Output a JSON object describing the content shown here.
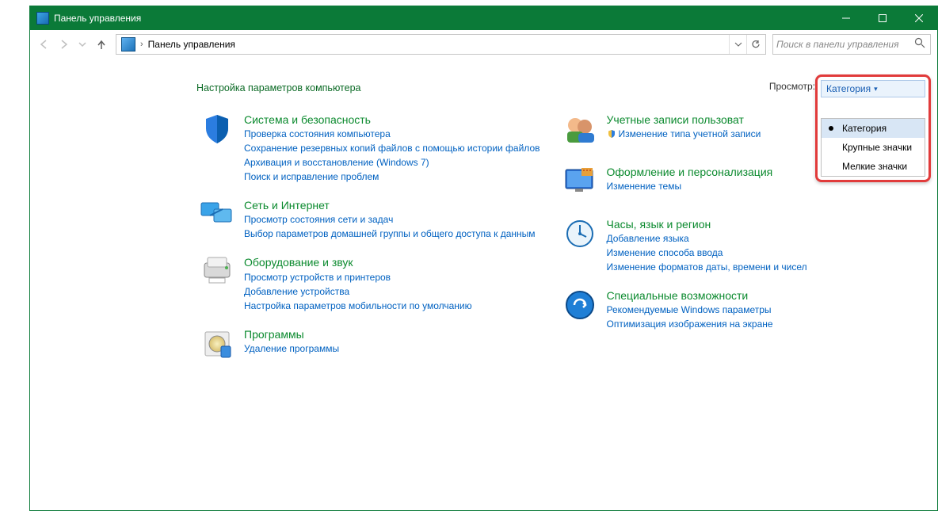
{
  "window": {
    "title": "Панель управления"
  },
  "breadcrumb": "Панель управления",
  "search_placeholder": "Поиск в панели управления",
  "page_title": "Настройка параметров компьютера",
  "view_by_label": "Просмотр:",
  "view_dropdown": "Категория",
  "view_menu": {
    "category": "Категория",
    "large": "Крупные значки",
    "small": "Мелкие значки"
  },
  "left_cats": [
    {
      "title": "Система и безопасность",
      "links": [
        {
          "text": "Проверка состояния компьютера"
        },
        {
          "text": "Сохранение резервных копий файлов с помощью истории файлов"
        },
        {
          "text": "Архивация и восстановление (Windows 7)"
        },
        {
          "text": "Поиск и исправление проблем"
        }
      ]
    },
    {
      "title": "Сеть и Интернет",
      "links": [
        {
          "text": "Просмотр состояния сети и задач"
        },
        {
          "text": "Выбор параметров домашней группы и общего доступа к данным"
        }
      ]
    },
    {
      "title": "Оборудование и звук",
      "links": [
        {
          "text": "Просмотр устройств и принтеров"
        },
        {
          "text": "Добавление устройства"
        },
        {
          "text": "Настройка параметров мобильности по умолчанию"
        }
      ]
    },
    {
      "title": "Программы",
      "links": [
        {
          "text": "Удаление программы"
        }
      ]
    }
  ],
  "right_cats": [
    {
      "title": "Учетные записи пользоват",
      "links": [
        {
          "text": "Изменение типа учетной записи",
          "shield": true
        }
      ]
    },
    {
      "title": "Оформление и персонализация",
      "links": [
        {
          "text": "Изменение темы"
        }
      ]
    },
    {
      "title": "Часы, язык и регион",
      "links": [
        {
          "text": "Добавление языка"
        },
        {
          "text": "Изменение способа ввода"
        },
        {
          "text": "Изменение форматов даты, времени и чисел"
        }
      ]
    },
    {
      "title": "Специальные возможности",
      "links": [
        {
          "text": "Рекомендуемые Windows параметры"
        },
        {
          "text": "Оптимизация изображения на экране"
        }
      ]
    }
  ]
}
